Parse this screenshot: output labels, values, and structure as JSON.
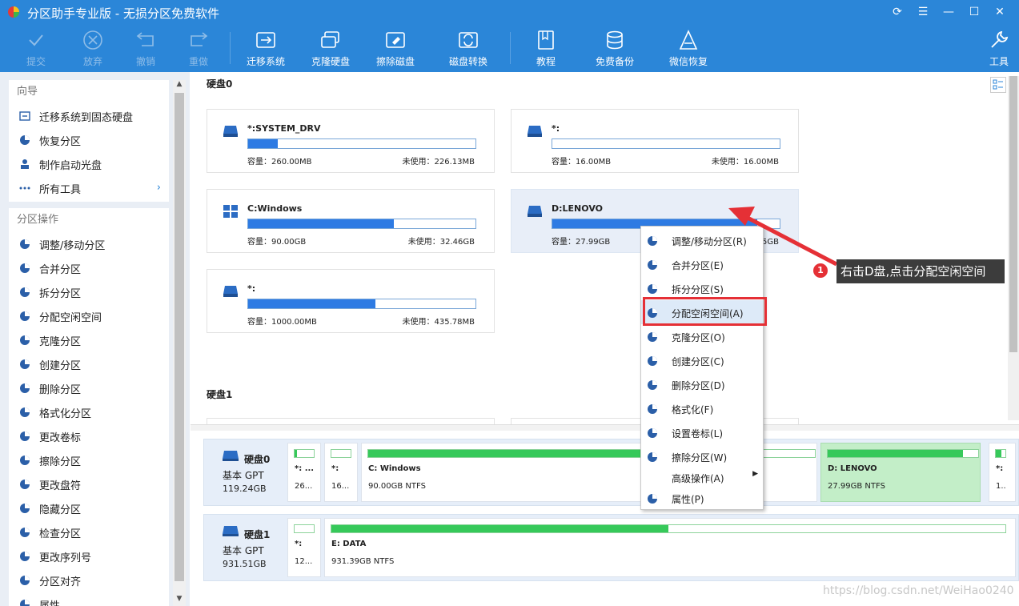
{
  "app": {
    "title": "分区助手专业版 - 无损分区免费软件"
  },
  "toolbar": {
    "submit": "提交",
    "discard": "放弃",
    "undo": "撤销",
    "redo": "重做",
    "migrate": "迁移系统",
    "clone": "克隆硬盘",
    "wipe": "擦除磁盘",
    "convert": "磁盘转换",
    "tutorial": "教程",
    "backup": "免费备份",
    "wechat": "微信恢复",
    "tools": "工具"
  },
  "sidebar": {
    "wizard_title": "向导",
    "wizard_items": [
      "迁移系统到固态硬盘",
      "恢复分区",
      "制作启动光盘",
      "所有工具"
    ],
    "ops_title": "分区操作",
    "ops_items": [
      "调整/移动分区",
      "合并分区",
      "拆分分区",
      "分配空闲空间",
      "克隆分区",
      "创建分区",
      "删除分区",
      "格式化分区",
      "更改卷标",
      "擦除分区",
      "更改盘符",
      "隐藏分区",
      "检查分区",
      "更改序列号",
      "分区对齐",
      "属性"
    ]
  },
  "disk0": {
    "title": "硬盘0",
    "cap_label": "容量：",
    "free_label": "未使用：",
    "partitions": [
      {
        "name": "*:SYSTEM_DRV",
        "capacity": "260.00MB",
        "free": "226.13MB",
        "used_fraction": 0.13
      },
      {
        "name": "*:",
        "capacity": "16.00MB",
        "free": "16.00MB",
        "used_fraction": 0
      },
      {
        "name": "C:Windows",
        "capacity": "90.00GB",
        "free": "32.46GB",
        "used_fraction": 0.64
      },
      {
        "name": "D:LENOVO",
        "capacity": "27.99GB",
        "free": "…5GB",
        "used_fraction": 0.9
      },
      {
        "name": "*:",
        "capacity": "1000.00MB",
        "free": "435.78MB",
        "used_fraction": 0.56
      }
    ]
  },
  "disk1": {
    "title": "硬盘1"
  },
  "diskmap": {
    "disk0": {
      "name": "硬盘0",
      "type": "基本 GPT",
      "size": "119.24GB",
      "blocks": [
        {
          "name": "*: ...",
          "info": "26...",
          "used_fraction": 0.13
        },
        {
          "name": "*:",
          "info": "16...",
          "used_fraction": 0
        },
        {
          "name": "C: Windows",
          "info": "90.00GB NTFS",
          "used_fraction": 0.64
        },
        {
          "name": "D: LENOVO",
          "info": "27.99GB NTFS",
          "used_fraction": 0.9
        },
        {
          "name": "*:",
          "info": "1..",
          "used_fraction": 0.56
        }
      ]
    },
    "disk1": {
      "name": "硬盘1",
      "type": "基本 GPT",
      "size": "931.51GB",
      "blocks": [
        {
          "name": "*:",
          "info": "12...",
          "used_fraction": 0
        },
        {
          "name": "E: DATA",
          "info": "931.39GB NTFS",
          "used_fraction": 0.5
        }
      ]
    }
  },
  "context_menu": {
    "items": [
      "调整/移动分区(R)",
      "合并分区(E)",
      "拆分分区(S)",
      "分配空闲空间(A)",
      "克隆分区(O)",
      "创建分区(C)",
      "删除分区(D)",
      "格式化(F)",
      "设置卷标(L)",
      "擦除分区(W)",
      "高级操作(A)",
      "属性(P)"
    ],
    "highlighted_index": 3
  },
  "annotation": {
    "number": "1",
    "text": "右击D盘,点击分配空闲空间"
  },
  "watermark": "https://blog.csdn.net/WeiHao0240",
  "colors": {
    "accent": "#2b86d8",
    "bar_blue": "#2e7be3",
    "bar_green": "#36c95a",
    "highlight_red": "#e53036"
  }
}
